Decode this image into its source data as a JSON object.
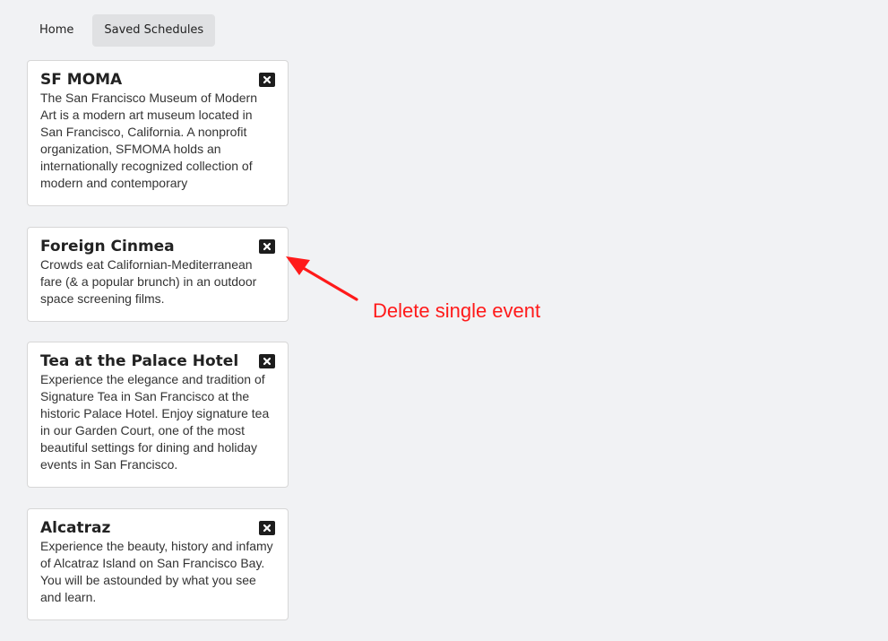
{
  "nav": {
    "tabs": [
      {
        "label": "Home"
      },
      {
        "label": "Saved Schedules"
      }
    ]
  },
  "events": [
    {
      "title": "SF MOMA",
      "description": "The San Francisco Museum of Modern Art is a modern art museum located in San Francisco, California. A nonprofit organization, SFMOMA holds an internationally recognized collection of modern and contemporary"
    },
    {
      "title": "Foreign Cinmea",
      "description": "Crowds eat Californian-Mediterranean fare (& a popular brunch) in an outdoor space screening films."
    },
    {
      "title": "Tea at the Palace Hotel",
      "description": "Experience the elegance and tradition of Signature Tea in San Francisco at the historic Palace Hotel. Enjoy signature tea in our Garden Court, one of the most beautiful settings for dining and holiday events in San Francisco."
    },
    {
      "title": "Alcatraz",
      "description": "Experience the beauty, history and infamy of Alcatraz Island on San Francisco Bay. You will be astounded by what you see and learn."
    }
  ],
  "annotation": {
    "text": "Delete single event",
    "color": "#ff1a1a"
  },
  "icons": {
    "delete": "close-icon"
  }
}
